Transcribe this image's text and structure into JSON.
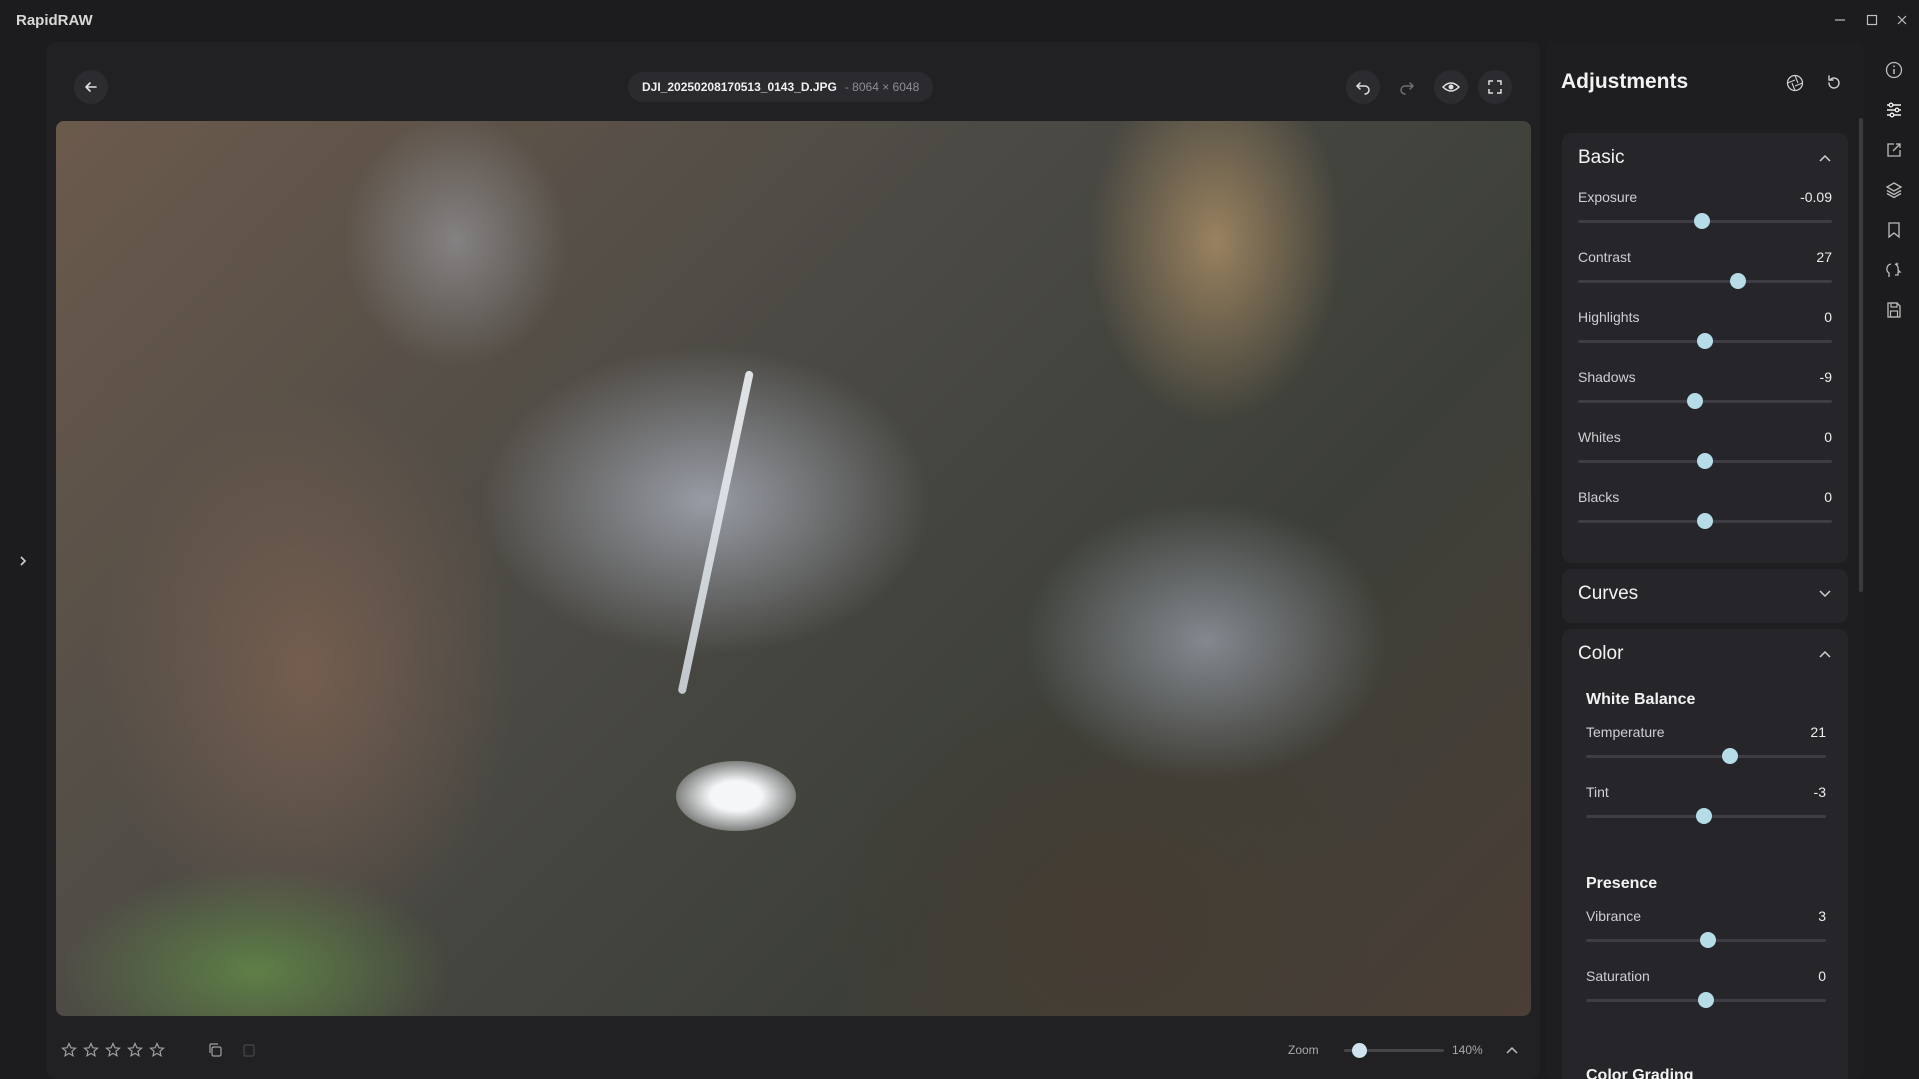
{
  "app": {
    "title": "RapidRAW"
  },
  "window_controls": [
    {
      "name": "minimize-button",
      "icon": "minimize-icon",
      "glyph": "–"
    },
    {
      "name": "maximize-button",
      "icon": "maximize-icon",
      "glyph": "☐"
    },
    {
      "name": "close-button",
      "icon": "close-icon",
      "glyph": "✕"
    }
  ],
  "viewer": {
    "file_name": "DJI_20250208170513_0143_D.JPG",
    "dimensions": "- 8064 × 6048",
    "tools": [
      "undo-icon",
      "redo-icon",
      "eye-icon",
      "fullscreen-icon"
    ]
  },
  "bottom": {
    "rating": 0,
    "max_rating": 5,
    "zoom_label": "Zoom",
    "zoom_value": "140%",
    "zoom_fraction": 0.08
  },
  "panel": {
    "title": "Adjustments",
    "basic": {
      "title": "Basic",
      "expanded": true,
      "sliders": [
        {
          "label": "Exposure",
          "value": "-0.09",
          "position": 0.49
        },
        {
          "label": "Contrast",
          "value": "27",
          "position": 0.63
        },
        {
          "label": "Highlights",
          "value": "0",
          "position": 0.5
        },
        {
          "label": "Shadows",
          "value": "-9",
          "position": 0.46
        },
        {
          "label": "Whites",
          "value": "0",
          "position": 0.5
        },
        {
          "label": "Blacks",
          "value": "0",
          "position": 0.5
        }
      ]
    },
    "curves": {
      "title": "Curves",
      "expanded": false
    },
    "color": {
      "title": "Color",
      "expanded": true,
      "white_balance": {
        "title": "White Balance",
        "sliders": [
          {
            "label": "Temperature",
            "value": "21",
            "position": 0.6
          },
          {
            "label": "Tint",
            "value": "-3",
            "position": 0.49
          }
        ]
      },
      "presence": {
        "title": "Presence",
        "sliders": [
          {
            "label": "Vibrance",
            "value": "3",
            "position": 0.51
          },
          {
            "label": "Saturation",
            "value": "0",
            "position": 0.5
          }
        ]
      },
      "color_grading": {
        "title": "Color Grading"
      }
    }
  },
  "rail": [
    "info-icon",
    "adjustments-icon",
    "crop-icon",
    "layers-icon",
    "bookmark-icon",
    "ai-icon",
    "export-icon"
  ],
  "colors": {
    "accent": "#b6dce8",
    "background": "#1c1c1e",
    "panel": "#26262a"
  }
}
